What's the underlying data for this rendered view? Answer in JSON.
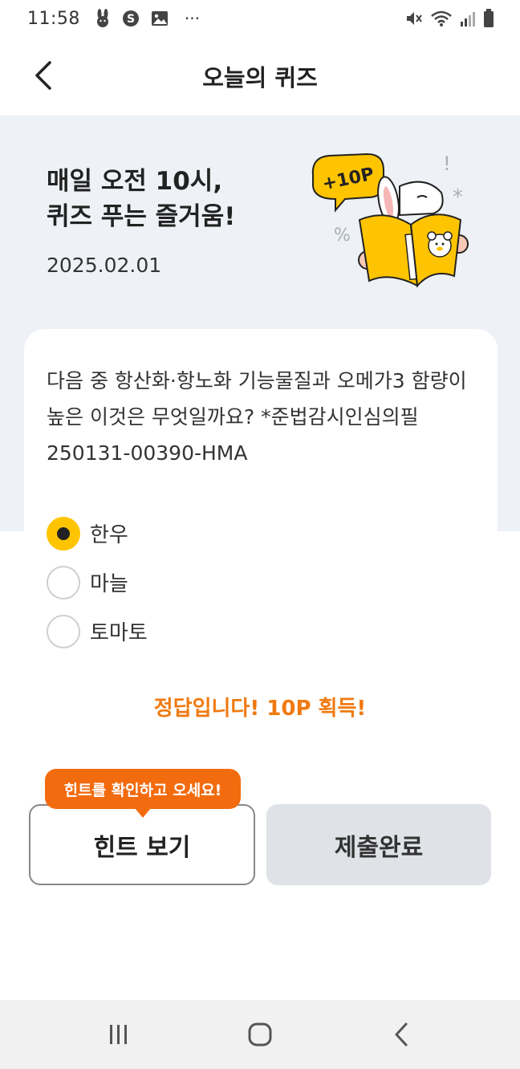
{
  "status_bar": {
    "time": "11:58",
    "left_icons": [
      "rabbit-icon",
      "s-icon",
      "gallery-icon",
      "more-icon"
    ],
    "more_glyph": "···",
    "right_icons": [
      "mute-icon",
      "wifi-icon",
      "signal-icon",
      "battery-icon"
    ]
  },
  "header": {
    "title": "오늘의 퀴즈",
    "back_icon": "back-icon"
  },
  "hero": {
    "heading_line1": "매일 오전 10시,",
    "heading_line2": "퀴즈 푸는 즐거움!",
    "date": "2025.02.01",
    "badge": "+10P"
  },
  "question": {
    "text": "다음 중 항산화·항노화 기능물질과 오메가3 함량이 높은 이것은 무엇일까요? *준법감시인심의필250131-00390-HMA"
  },
  "options": [
    {
      "label": "한우",
      "selected": true
    },
    {
      "label": "마늘",
      "selected": false
    },
    {
      "label": "토마토",
      "selected": false
    }
  ],
  "result": {
    "message": "정답입니다! 10P 획득!"
  },
  "buttons": {
    "hint_tooltip": "힌트를 확인하고 오세요!",
    "hint_label": "힌트 보기",
    "submit_label": "제출완료"
  },
  "colors": {
    "accent_yellow": "#ffc400",
    "result_orange": "#f07a10",
    "tooltip_orange": "#f26b0e",
    "hero_background": "#eef1f6",
    "submit_background": "#dfe2e6"
  },
  "nav": {
    "items": [
      "recent-apps-icon",
      "home-icon",
      "back-nav-icon"
    ]
  }
}
